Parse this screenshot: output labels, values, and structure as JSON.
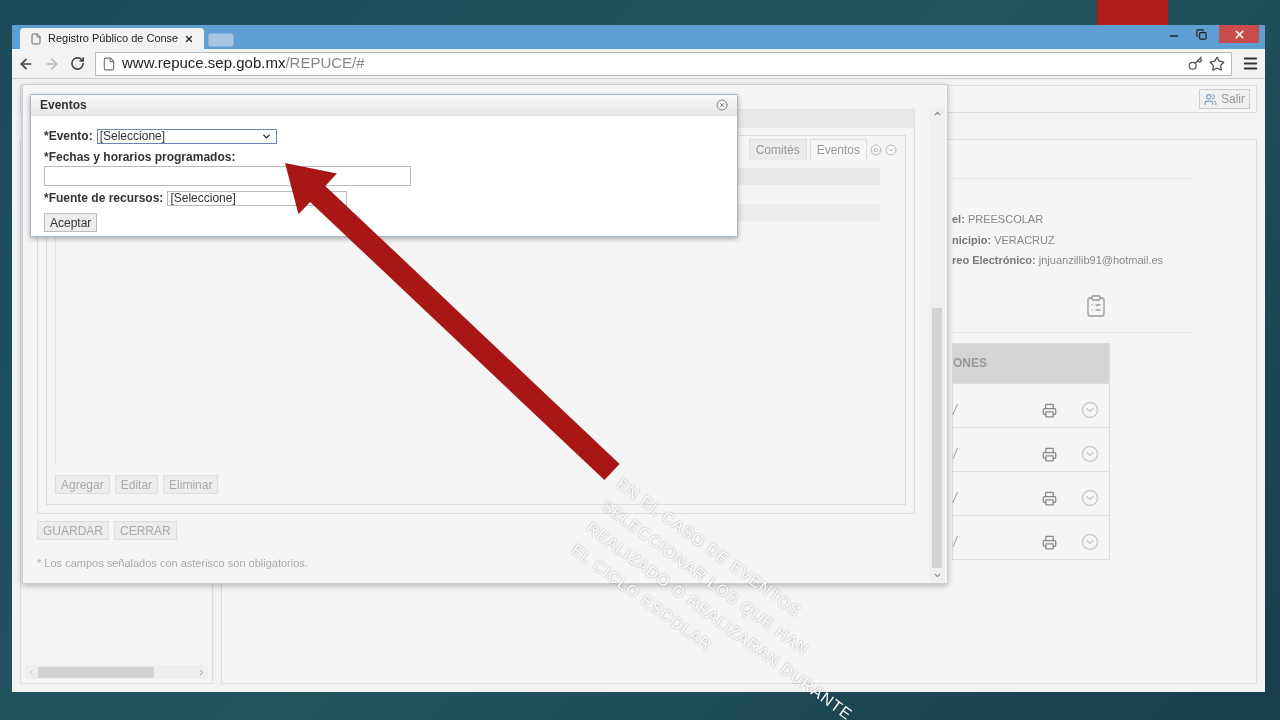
{
  "slide": {
    "annotation": [
      "EN EL CASO DE EVENTOS",
      "SELECCIONAR LOS QUE HAN",
      "REALIZADO O REALIZARAN DURANTE",
      "EL CICLO ESCOLAR"
    ]
  },
  "browser": {
    "tabs": [
      {
        "title": "Registro Público de Conse",
        "selected": true
      }
    ],
    "url": {
      "host": "www.repuce.sep.gob.mx",
      "path": "/REPUCE/#"
    }
  },
  "page": {
    "logout_button": "Salir",
    "info": [
      {
        "label": "el:",
        "value": "PREESCOLAR"
      },
      {
        "label": "nicipio:",
        "value": "VERACRUZ"
      },
      {
        "label": "reo Electrónico:",
        "value": "jnjuanzillib91@hotmail.es"
      }
    ],
    "table": {
      "header": "ONES",
      "rows": [
        {
          "column_1": "/"
        },
        {
          "column_1": "/"
        },
        {
          "column_1": "/"
        },
        {
          "column_1": "/"
        }
      ]
    }
  },
  "modal": {
    "tabs": [
      {
        "label": "Comités",
        "selected": false
      },
      {
        "label": "Eventos",
        "selected": true
      }
    ],
    "list_buttons": [
      "Agregar",
      "Editar",
      "Eliminar"
    ],
    "buttons": [
      "GUARDAR",
      "CERRAR"
    ],
    "note": "* Los campos señalados con asterisco son obligatorios."
  },
  "dialog": {
    "title": "Eventos",
    "fields": [
      {
        "kind": "select",
        "label": "*Evento:",
        "value": "[Seleccione]"
      },
      {
        "kind": "text",
        "label": "*Fechas y horarios programados:"
      },
      {
        "kind": "select",
        "label": "*Fuente de recursos:",
        "value": "[Seleccione]"
      }
    ],
    "submit": "Aceptar"
  }
}
